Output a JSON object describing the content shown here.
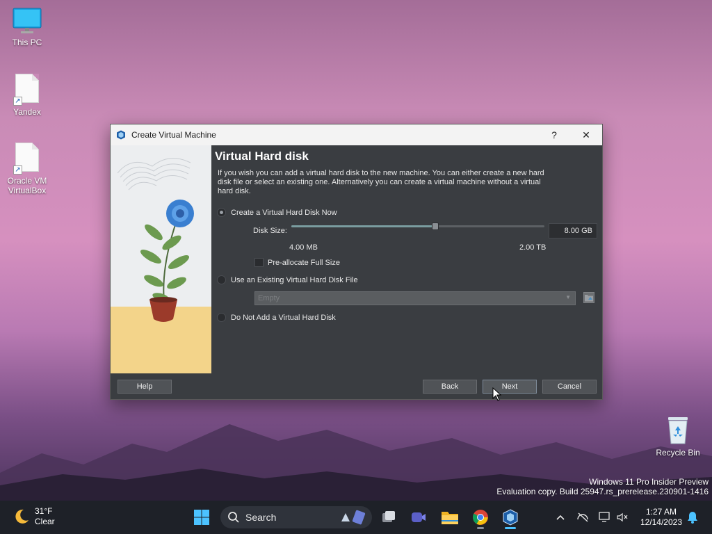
{
  "desktop": {
    "icons": [
      {
        "label": "This PC"
      },
      {
        "label": "Yandex"
      },
      {
        "label": "Oracle VM VirtualBox"
      },
      {
        "label": "Recycle Bin"
      }
    ],
    "watermark": {
      "line1": "Windows 11 Pro Insider Preview",
      "line2": "Evaluation copy. Build 25947.rs_prerelease.230901-1416"
    }
  },
  "window": {
    "title": "Create Virtual Machine",
    "help_glyph": "?",
    "close_glyph": "✕",
    "heading": "Virtual Hard disk",
    "description": "If you wish you can add a virtual hard disk to the new machine. You can either create a new hard disk file or select an existing one. Alternatively you can create a virtual machine without a virtual hard disk.",
    "options": {
      "create_new": {
        "label": "Create a Virtual Hard Disk Now",
        "selected": true
      },
      "use_existing": {
        "label": "Use an Existing Virtual Hard Disk File",
        "selected": false
      },
      "do_not_add": {
        "label": "Do Not Add a Virtual Hard Disk",
        "selected": false
      }
    },
    "disk_size": {
      "label": "Disk Size:",
      "value": "8.00 GB",
      "min_label": "4.00 MB",
      "max_label": "2.00 TB",
      "slider_fraction": 0.57
    },
    "preallocate": {
      "label": "Pre-allocate Full Size",
      "checked": false
    },
    "existing_file_combo": {
      "value": "Empty"
    },
    "buttons": {
      "help": "Help",
      "back": "Back",
      "next": "Next",
      "cancel": "Cancel"
    }
  },
  "taskbar": {
    "weather": {
      "temp": "31°F",
      "condition": "Clear"
    },
    "search_label": "Search",
    "clock": {
      "time": "1:27 AM",
      "date": "12/14/2023"
    },
    "pinned": [
      "start-icon",
      "search-icon",
      "task-view-icon",
      "meet-icon",
      "file-explorer-icon",
      "chrome-icon",
      "virtualbox-icon"
    ],
    "tray": [
      "chevron-up-icon",
      "network-off-icon",
      "display-icon",
      "volume-muted-icon",
      "notification-bell-icon"
    ]
  },
  "colors": {
    "accent": "#3b86d4",
    "window_bg": "#3a3d41",
    "taskbar_bg": "#1e2128"
  }
}
